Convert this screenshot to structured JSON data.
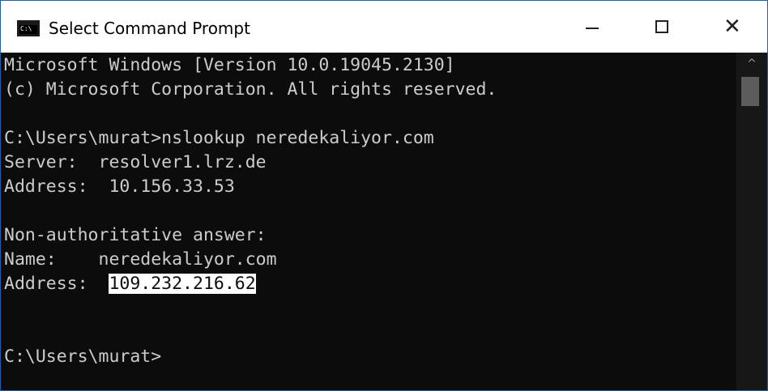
{
  "window": {
    "title": "Select Command Prompt",
    "icon_label": "C:\\",
    "controls": {
      "minimize": "minimize-icon",
      "maximize": "maximize-icon",
      "close": "close-icon",
      "close_glyph": "✕"
    }
  },
  "console": {
    "lines": [
      "Microsoft Windows [Version 10.0.19045.2130]",
      "(c) Microsoft Corporation. All rights reserved.",
      "",
      "C:\\Users\\murat>nslookup neredekaliyor.com",
      "Server:  resolver1.lrz.de",
      "Address:  10.156.33.53",
      "",
      "Non-authoritative answer:",
      "Name:    neredekaliyor.com",
      "Address:  ",
      "",
      "",
      "C:\\Users\\murat>"
    ],
    "selected_text": "109.232.216.62"
  },
  "scrollbar": {
    "up_arrow": "^"
  },
  "colors": {
    "background": "#0c0c0c",
    "text": "#cccccc",
    "selection_bg": "#ffffff",
    "titlebar": "#ffffff"
  }
}
